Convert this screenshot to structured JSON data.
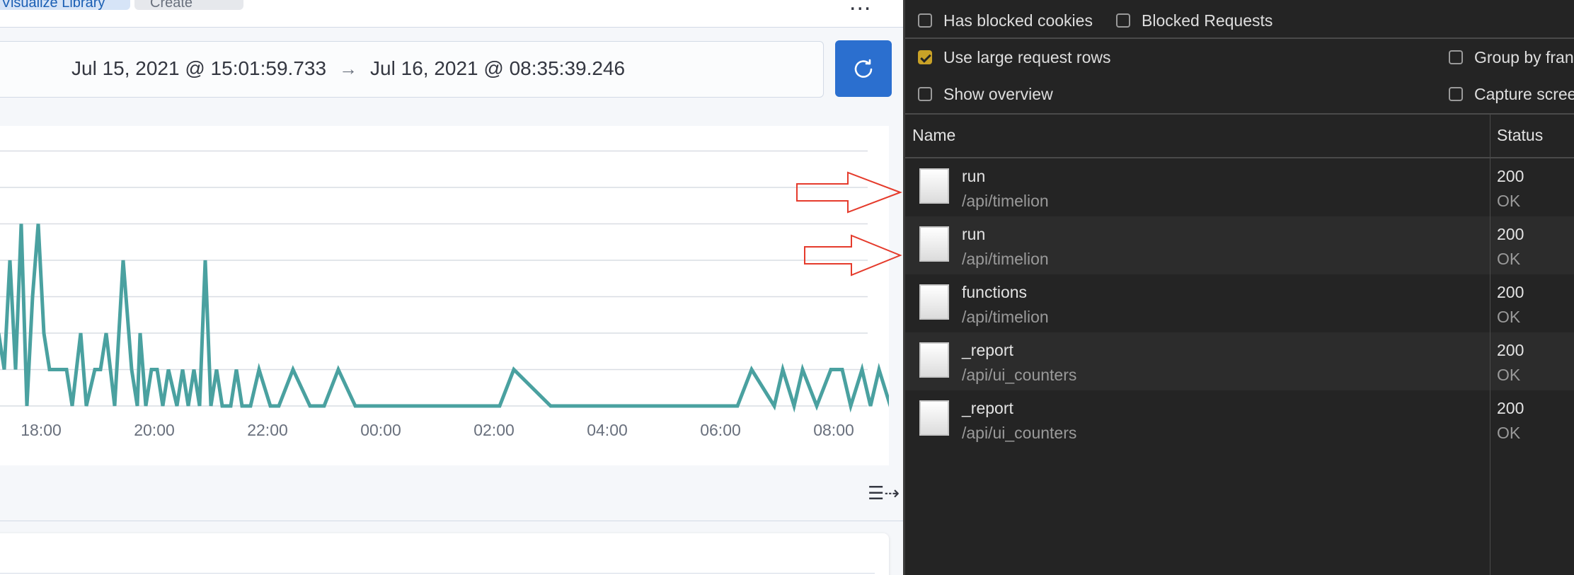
{
  "kibana": {
    "breadcrumbs": [
      "Visualize Library",
      "Create"
    ],
    "more_label": "...",
    "time_start": "Jul 15, 2021 @ 15:01:59.733",
    "time_arrow": "→",
    "time_end": "Jul 16, 2021 @ 08:35:39.246",
    "refresh_icon": "refresh-icon",
    "wrap_icon": "text-wrap-icon",
    "colors": {
      "refresh_button": "#2b6fcf",
      "series": "#4aa1a0",
      "annotation": "#e53b2c"
    }
  },
  "chart_data": {
    "type": "line",
    "x_tick_labels": [
      "18:00",
      "20:00",
      "22:00",
      "00:00",
      "02:00",
      "04:00",
      "06:00",
      "08:00"
    ],
    "grid": true,
    "series": [
      {
        "x": [
          17.25,
          17.35,
          17.45,
          17.55,
          17.65,
          17.75,
          17.85,
          17.95,
          18.05,
          18.15,
          18.3,
          18.45,
          18.55,
          18.7,
          18.8,
          18.95,
          19.05,
          19.15,
          19.3,
          19.45,
          19.6,
          19.7,
          19.75,
          19.85,
          19.95,
          20.05,
          20.15,
          20.25,
          20.4,
          20.5,
          20.6,
          20.7,
          20.8,
          20.9,
          21.0,
          21.1,
          21.2,
          21.35,
          21.45,
          21.55,
          21.7,
          21.85,
          22.05,
          22.2,
          22.45,
          22.75,
          23.0,
          23.25,
          23.55,
          26.1,
          26.35,
          27.0,
          30.3,
          30.55,
          30.95,
          31.1,
          31.3,
          31.45,
          31.7,
          31.95,
          32.15,
          32.3,
          32.5,
          32.65,
          32.8,
          33.0,
          33.2,
          33.3,
          33.5,
          33.65
        ],
        "y": [
          2,
          1,
          4,
          1,
          5,
          0,
          3,
          5,
          2,
          1,
          1,
          1,
          0,
          2,
          0,
          1,
          1,
          2,
          0,
          4,
          1,
          0,
          2,
          0,
          1,
          1,
          0,
          1,
          0,
          1,
          0,
          1,
          0,
          4,
          0,
          1,
          0,
          0,
          1,
          0,
          0,
          1,
          0,
          0,
          1,
          0,
          0,
          1,
          0,
          0,
          1,
          0,
          0,
          1,
          0,
          1,
          0,
          1,
          0,
          1,
          1,
          0,
          1,
          0,
          1,
          0,
          1,
          1,
          0,
          1
        ],
        "color": "#4aa1a0"
      }
    ]
  },
  "devtools": {
    "options": {
      "has_blocked_cookies": "Has blocked cookies",
      "blocked_requests": "Blocked Requests",
      "use_large_rows": "Use large request rows",
      "group_by_frame": "Group by fran",
      "show_overview": "Show overview",
      "capture_screenshots": "Capture scree"
    },
    "checked": {
      "use_large_rows": true
    },
    "columns": {
      "name": "Name",
      "status": "Status"
    },
    "requests": [
      {
        "name": "run",
        "path": "/api/timelion",
        "code": "200",
        "text": "OK"
      },
      {
        "name": "run",
        "path": "/api/timelion",
        "code": "200",
        "text": "OK"
      },
      {
        "name": "functions",
        "path": "/api/timelion",
        "code": "200",
        "text": "OK"
      },
      {
        "name": "_report",
        "path": "/api/ui_counters",
        "code": "200",
        "text": "OK"
      },
      {
        "name": "_report",
        "path": "/api/ui_counters",
        "code": "200",
        "text": "OK"
      }
    ],
    "colors": {
      "background": "#242424",
      "checkbox_checked": "#c9a227"
    }
  }
}
